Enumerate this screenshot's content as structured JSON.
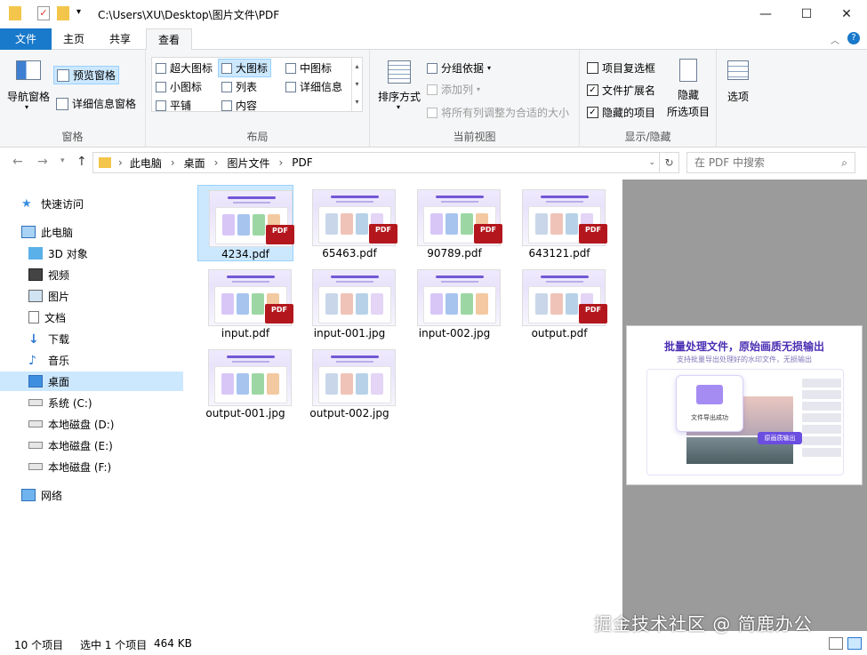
{
  "title": {
    "path": "C:\\Users\\XU\\Desktop\\图片文件\\PDF"
  },
  "tabs": [
    "文件",
    "主页",
    "共享",
    "查看"
  ],
  "ribbon": {
    "panes": {
      "nav_pane": "导航窗格",
      "preview_pane": "预览窗格",
      "details_pane": "详细信息窗格",
      "label": "窗格"
    },
    "layout": {
      "items": [
        "超大图标",
        "大图标",
        "中图标",
        "小图标",
        "列表",
        "详细信息",
        "平铺",
        "内容"
      ],
      "label": "布局"
    },
    "current_view": {
      "sort": "排序方式",
      "group_by": "分组依据",
      "add_column": "添加列",
      "fit_columns": "将所有列调整为合适的大小",
      "label": "当前视图"
    },
    "show_hide": {
      "item_checkboxes": "项目复选框",
      "file_extensions": "文件扩展名",
      "hidden_items": "隐藏的项目",
      "hide_selected_1": "隐藏",
      "hide_selected_2": "所选项目",
      "label": "显示/隐藏"
    },
    "options": "选项"
  },
  "address": {
    "crumbs": [
      "此电脑",
      "桌面",
      "图片文件",
      "PDF"
    ],
    "search_placeholder": "在 PDF 中搜索"
  },
  "sidebar": {
    "quick_access": "快速访问",
    "this_pc": "此电脑",
    "items": [
      "3D 对象",
      "视频",
      "图片",
      "文档",
      "下载",
      "音乐",
      "桌面",
      "系统 (C:)",
      "本地磁盘 (D:)",
      "本地磁盘 (E:)",
      "本地磁盘 (F:)"
    ],
    "network": "网络"
  },
  "files": [
    {
      "name": "4234.pdf",
      "pdf": true
    },
    {
      "name": "65463.pdf",
      "pdf": true
    },
    {
      "name": "90789.pdf",
      "pdf": true
    },
    {
      "name": "643121.pdf",
      "pdf": true
    },
    {
      "name": "input.pdf",
      "pdf": true
    },
    {
      "name": "input-001.jpg",
      "pdf": false
    },
    {
      "name": "input-002.jpg",
      "pdf": false
    },
    {
      "name": "output.pdf",
      "pdf": true
    },
    {
      "name": "output-001.jpg",
      "pdf": false
    },
    {
      "name": "output-002.jpg",
      "pdf": false
    }
  ],
  "pdf_badge": "PDF",
  "preview": {
    "title": "批量处理文件，原始画质无损输出",
    "subtitle": "支持批量导出处理好的水印文件，无损输出",
    "popup": "文件导出成功",
    "button": "原画质输出"
  },
  "status": {
    "count": "10 个项目",
    "selected": "选中 1 个项目",
    "size": "464 KB"
  },
  "watermark": "掘金技术社区 @ 简鹿办公",
  "colors": {
    "accent": "#1979ca",
    "selection": "#cce8ff",
    "pdf_red": "#b3171d"
  }
}
